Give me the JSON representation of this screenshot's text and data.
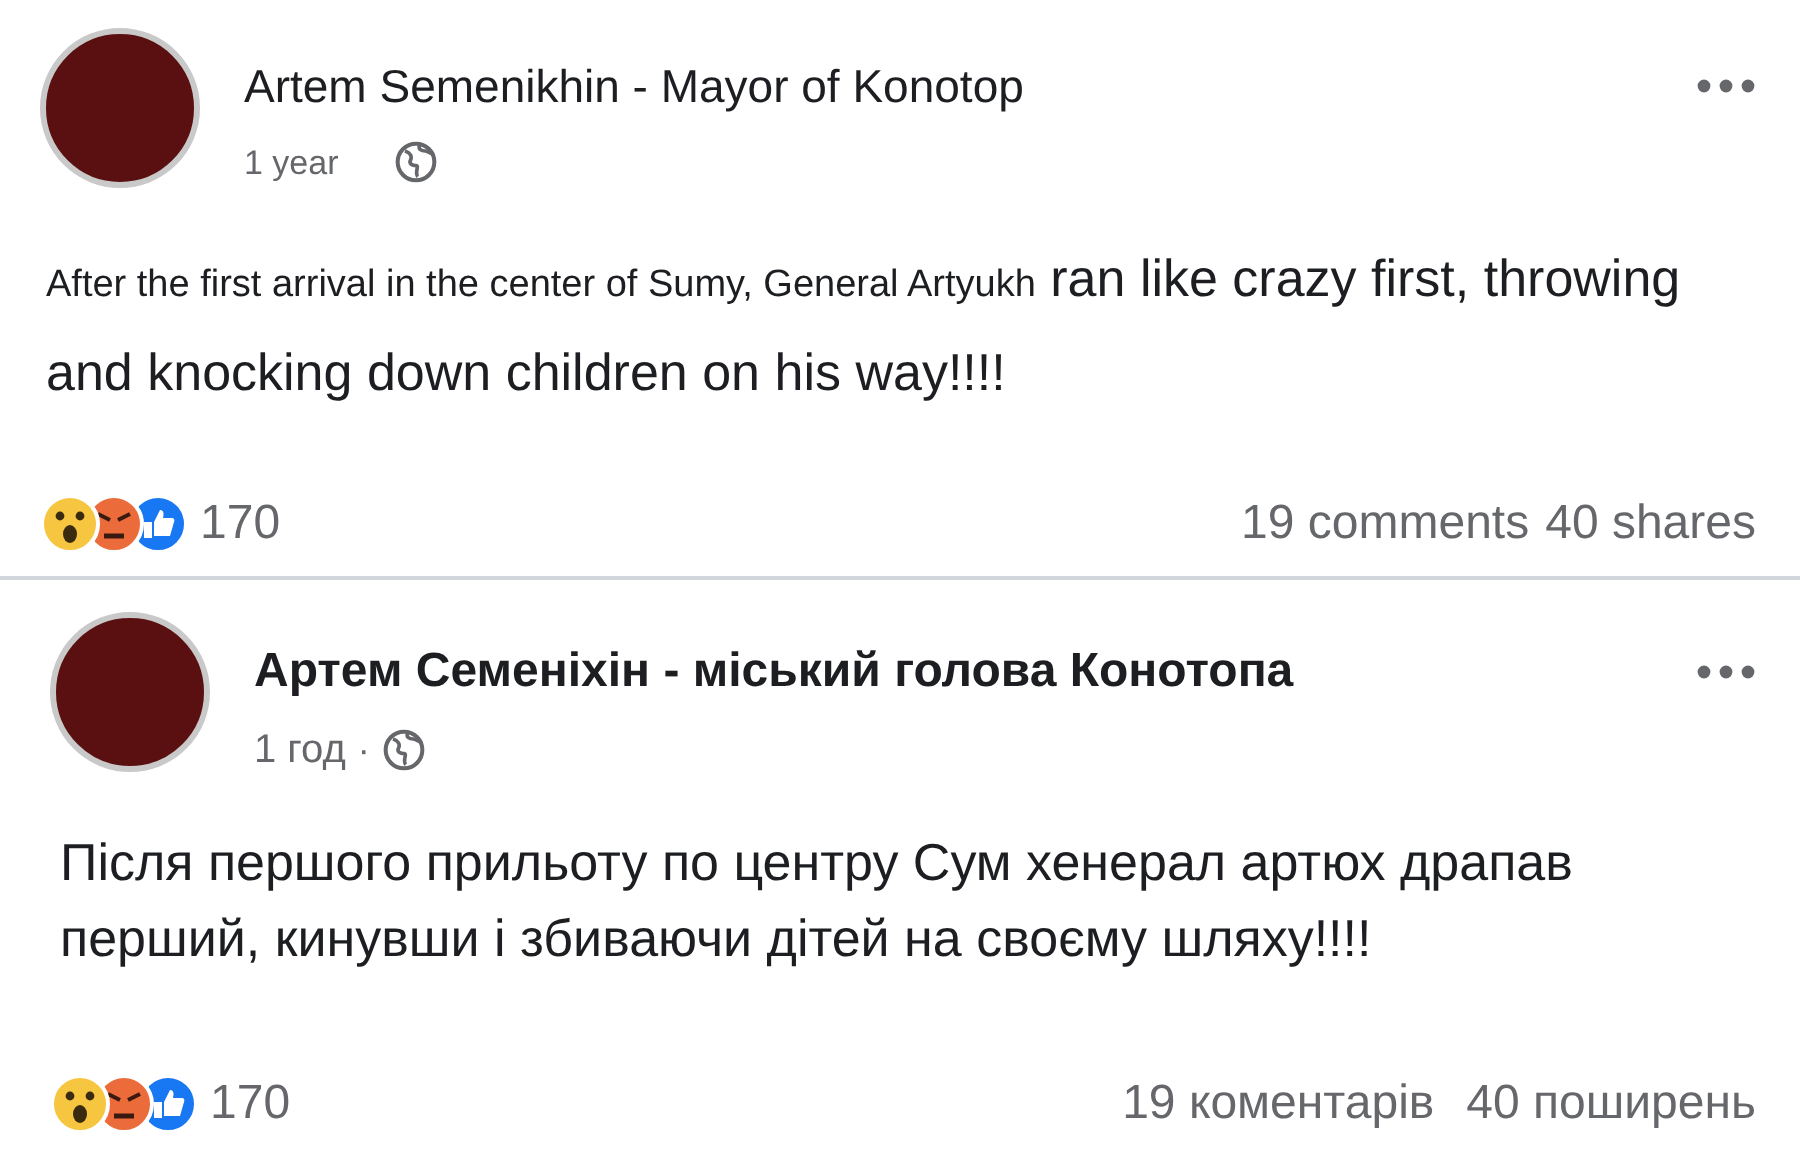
{
  "posts": [
    {
      "kind": "translated",
      "author": "Artem Semenikhin - Mayor of Konotop",
      "time": "1 year",
      "body": [
        {
          "kind": "small",
          "text": "After the first arrival in the center of Sumy, General Artyukh"
        },
        {
          "kind": "large",
          "text": "ran like crazy first, throwing and knocking down children on his way!!!!"
        }
      ],
      "reaction_count": "170",
      "comments": "19 comments",
      "shares": "40 shares"
    },
    {
      "kind": "original",
      "author": "Артем Семеніхін - міський голова Конотопа",
      "time": "1 год",
      "separator": "·",
      "body": [
        {
          "kind": "large",
          "text": "Після першого прильоту по центру Сум хенерал артюх драпав перший, кинувши і збиваючи дітей на своєму шляху!!!!"
        }
      ],
      "reaction_count": "170",
      "comments": "19 коментарів",
      "shares": "40 поширень"
    }
  ]
}
